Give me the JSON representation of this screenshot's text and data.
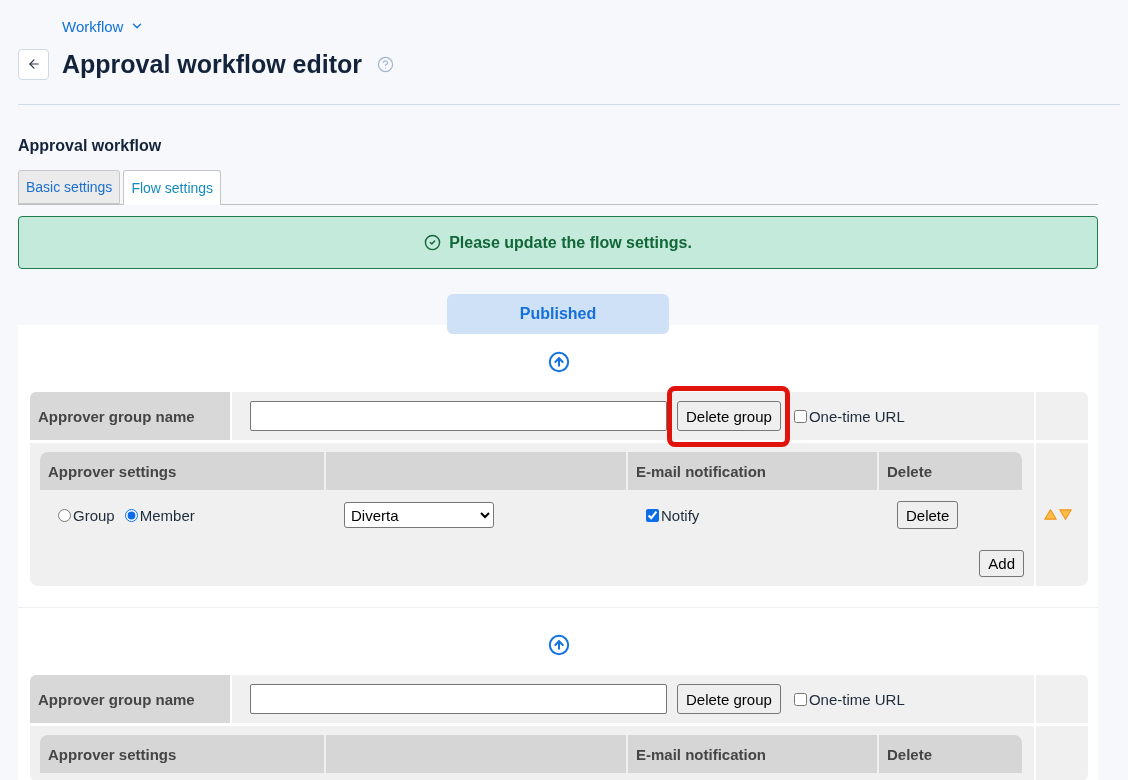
{
  "breadcrumb": {
    "label": "Workflow"
  },
  "page": {
    "title": "Approval workflow editor"
  },
  "section": {
    "title": "Approval workflow"
  },
  "tabs": [
    {
      "label": "Basic settings",
      "selected": false
    },
    {
      "label": "Flow settings",
      "selected": true
    }
  ],
  "alert": {
    "message": "Please update the flow settings."
  },
  "status_badge": {
    "label": "Published"
  },
  "groups": [
    {
      "highlighted": true,
      "name_label": "Approver group name",
      "delete_button": "Delete group",
      "one_time_url": {
        "label": "One-time URL",
        "checked": false
      },
      "columns": [
        {
          "kind": "text",
          "label": "Approver settings"
        },
        {
          "kind": "blank"
        },
        {
          "kind": "text",
          "label": "E-mail notification"
        },
        {
          "kind": "text",
          "label": "Delete"
        }
      ],
      "rows": [
        {
          "options": [
            {
              "label": "Group",
              "selected": false
            },
            {
              "label": "Member",
              "selected": true
            }
          ],
          "member": "Diverta",
          "notify": {
            "label": "Notify",
            "checked": true
          },
          "delete_button": "Delete"
        }
      ],
      "add_button": "Add"
    },
    {
      "highlighted": false,
      "name_label": "Approver group name",
      "delete_button": "Delete group",
      "one_time_url": {
        "label": "One-time URL",
        "checked": false
      },
      "columns": [
        {
          "kind": "text",
          "label": "Approver settings"
        },
        {
          "kind": "blank"
        },
        {
          "kind": "text",
          "label": "E-mail notification"
        },
        {
          "kind": "text",
          "label": "Delete"
        }
      ]
    }
  ]
}
